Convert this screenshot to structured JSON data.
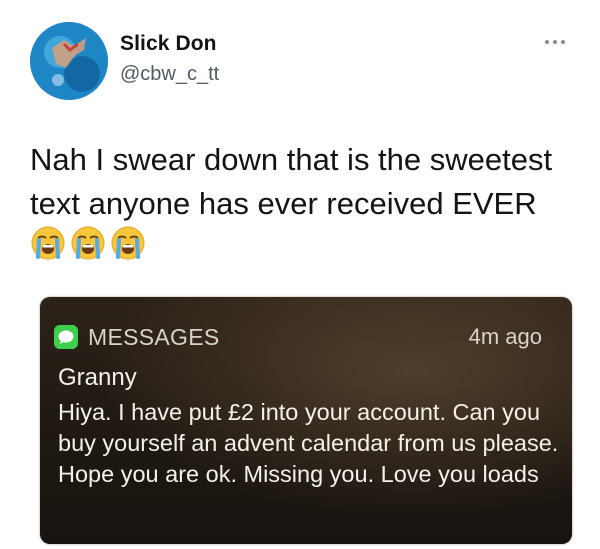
{
  "tweet": {
    "display_name": "Slick Don",
    "handle": "@cbw_c_tt",
    "text": "Nah I swear down that is the sweetest text anyone has ever received EVER",
    "emojis": [
      "loudly-crying-face",
      "loudly-crying-face",
      "loudly-crying-face"
    ],
    "more_icon": "more-horizontal-icon",
    "avatar_icon": "avatar-image"
  },
  "notification": {
    "app_name": "MESSAGES",
    "app_icon": "messages-app-icon",
    "time": "4m ago",
    "sender": "Granny",
    "body": "Hiya. I have put £2 into your account. Can you buy yourself an advent calendar from us please. Hope you are ok. Missing you. Love you loads",
    "accent_color": "#3fcf4f"
  }
}
